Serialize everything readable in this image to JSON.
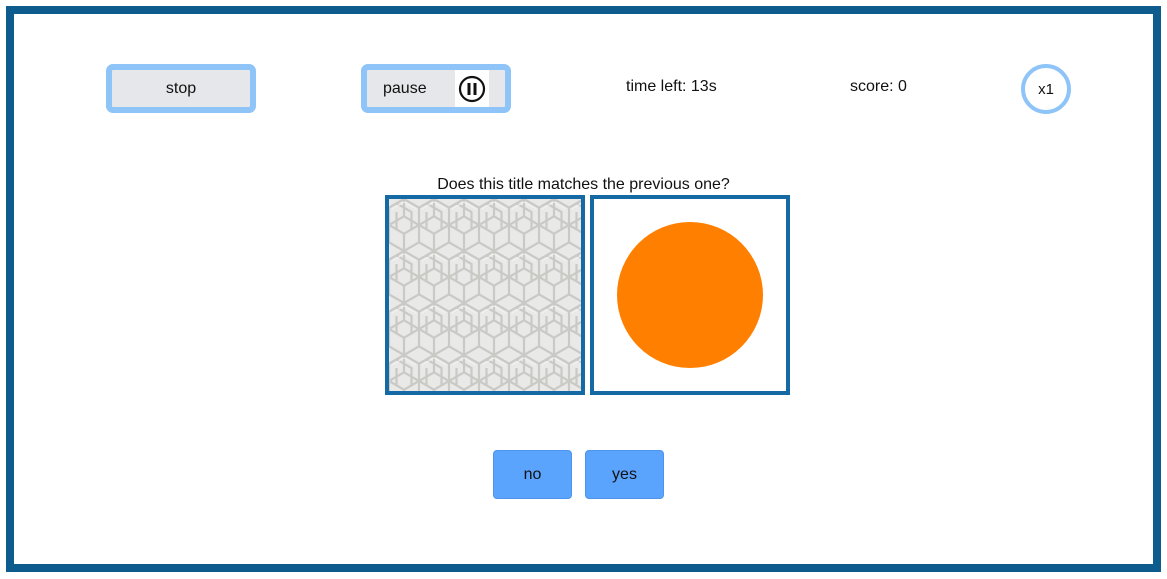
{
  "controls": {
    "stop_label": "stop",
    "pause_label": "pause"
  },
  "status": {
    "time_left": "time left: 13s",
    "score": "score: 0",
    "multiplier": "x1"
  },
  "question": {
    "text": "Does this title matches the previous one?"
  },
  "tiles": {
    "previous": {
      "content": "hexagonal-cube-pattern"
    },
    "current": {
      "content": "orange-circle",
      "color": "#ff7f00"
    }
  },
  "answers": {
    "no_label": "no",
    "yes_label": "yes"
  },
  "colors": {
    "frame": "#0e5c8e",
    "button_outline": "#8ec4f8",
    "tile_border": "#1569a4",
    "answer_button": "#5ba4fe",
    "circle": "#ff7f00"
  }
}
